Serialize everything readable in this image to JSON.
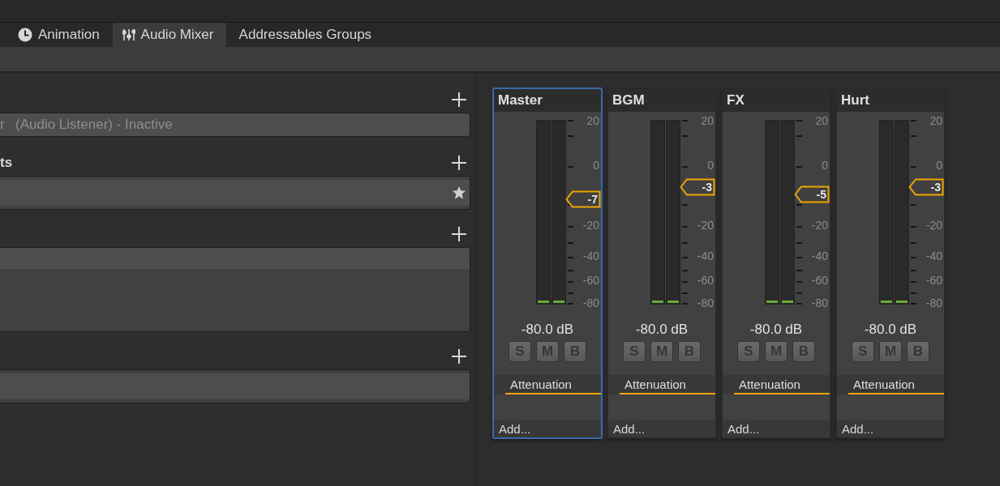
{
  "tabs": [
    {
      "label": "Animation",
      "selected": false
    },
    {
      "label": "Audio Mixer",
      "selected": true
    },
    {
      "label": "Addressables Groups",
      "selected": false
    }
  ],
  "inspector": {
    "sections": [
      {
        "kind": "field",
        "prefix": "r",
        "value": "(Audio Listener) - Inactive"
      },
      {
        "kind": "starred_field",
        "label": "ts"
      },
      {
        "kind": "list"
      },
      {
        "kind": "field"
      }
    ]
  },
  "mixer": {
    "groups": [
      {
        "name": "Master",
        "selected": true,
        "scale_labels": [
          "20",
          "0",
          "-20",
          "-40",
          "-60",
          "-80"
        ],
        "fader_value": "-7",
        "level": 0.57,
        "reading": "-80.0 dB",
        "buttons": [
          "S",
          "M",
          "B"
        ],
        "effects": [
          "Attenuation"
        ],
        "add_label": "Add..."
      },
      {
        "name": "BGM",
        "selected": false,
        "scale_labels": [
          "20",
          "0",
          "-20",
          "-40",
          "-60",
          "-80"
        ],
        "fader_value": "-3",
        "level": 0.634,
        "reading": "-80.0 dB",
        "buttons": [
          "S",
          "M",
          "B"
        ],
        "effects": [
          "Attenuation"
        ],
        "add_label": "Add..."
      },
      {
        "name": "FX",
        "selected": false,
        "scale_labels": [
          "20",
          "0",
          "-20",
          "-40",
          "-60",
          "-80"
        ],
        "fader_value": "-5",
        "level": 0.595,
        "reading": "-80.0 dB",
        "buttons": [
          "S",
          "M",
          "B"
        ],
        "effects": [
          "Attenuation"
        ],
        "add_label": "Add..."
      },
      {
        "name": "Hurt",
        "selected": false,
        "scale_labels": [
          "20",
          "0",
          "-20",
          "-40",
          "-60",
          "-80"
        ],
        "fader_value": "-3",
        "level": 0.634,
        "reading": "-80.0 dB",
        "buttons": [
          "S",
          "M",
          "B"
        ],
        "effects": [
          "Attenuation"
        ],
        "add_label": "Add..."
      }
    ]
  }
}
